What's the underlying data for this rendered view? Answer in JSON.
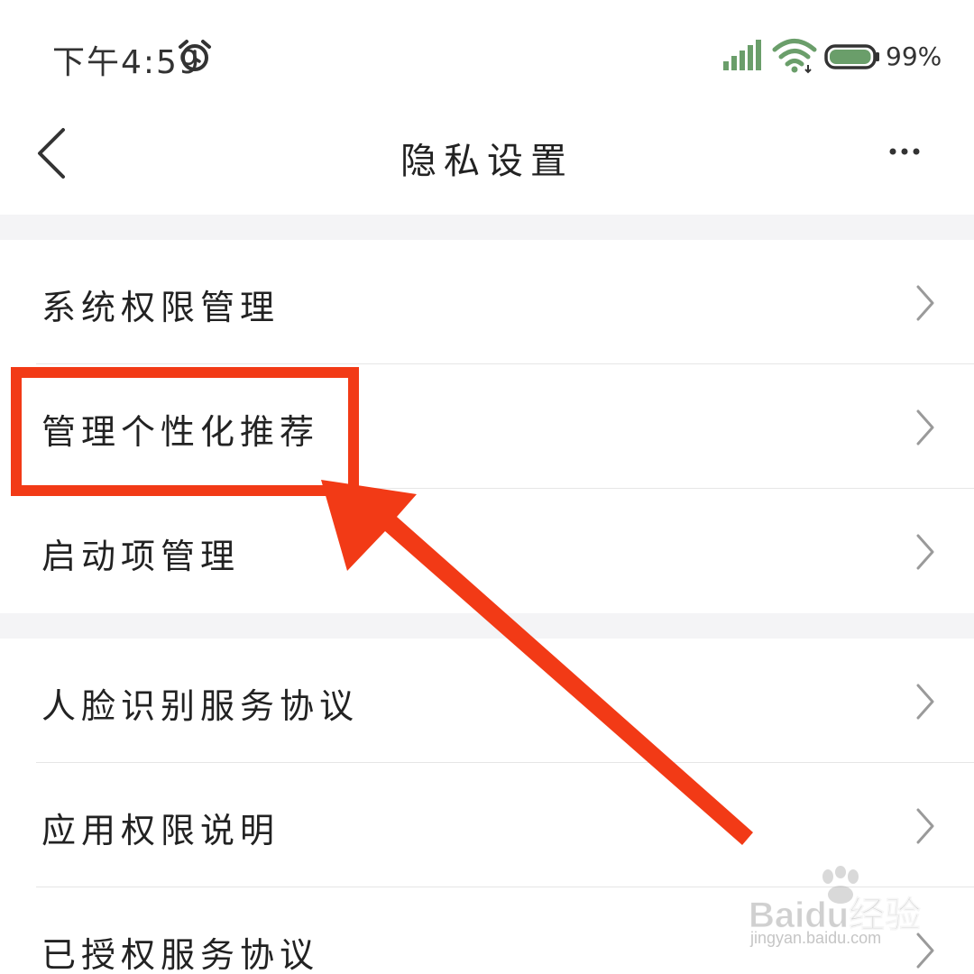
{
  "status_bar": {
    "time": "下午4:59",
    "alarm_icon": "alarm-clock-icon",
    "signal_icon": "cellular-signal-icon",
    "wifi_icon": "wifi-icon",
    "battery_icon": "battery-icon",
    "battery_level": "99%",
    "battery_fraction": 0.99,
    "battery_color": "#6a9e6a"
  },
  "nav": {
    "title": "隐私设置",
    "back_icon": "chevron-left-icon",
    "more_icon": "more-horizontal-icon"
  },
  "sections": [
    {
      "items": [
        {
          "label": "系统权限管理"
        },
        {
          "label": "管理个性化推荐"
        },
        {
          "label": "启动项管理"
        }
      ]
    },
    {
      "items": [
        {
          "label": "人脸识别服务协议"
        },
        {
          "label": "应用权限说明"
        },
        {
          "label": "已授权服务协议"
        }
      ]
    }
  ],
  "annotation": {
    "highlighted_item": "管理个性化推荐",
    "color": "#f23a16"
  },
  "watermark": {
    "logo_text": "Baidu经验",
    "url": "jingyan.baidu.com"
  },
  "colors": {
    "section_gap": "#f4f4f6",
    "chevron": "#9a9a9a",
    "divider": "#e6e6e6"
  }
}
